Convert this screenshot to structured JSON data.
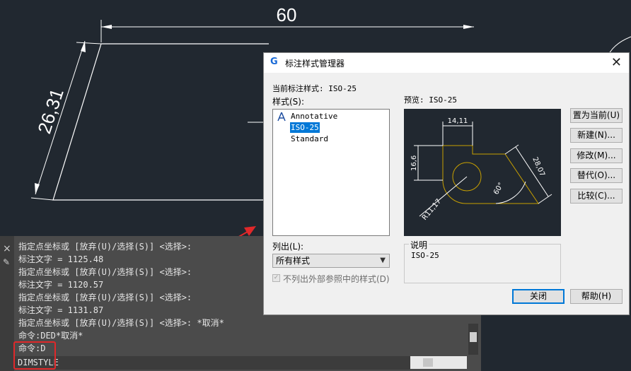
{
  "drawing": {
    "dim_top": "60",
    "dim_left": "26,31"
  },
  "command_window": {
    "lines": [
      "指定点坐标或 [放弃(U)/选择(S)] <选择>:",
      "标注文字 = 1125.48",
      "指定点坐标或 [放弃(U)/选择(S)] <选择>:",
      "标注文字 = 1120.57",
      "指定点坐标或 [放弃(U)/选择(S)] <选择>:",
      "标注文字 = 1131.87",
      "指定点坐标或 [放弃(U)/选择(S)] <选择>: *取消*",
      "命令:DED*取消*",
      "命令:D"
    ],
    "input_value": "DIMSTYLE",
    "close_glyph": "×",
    "pencil_glyph": "✎"
  },
  "dialog": {
    "title": "标注样式管理器",
    "logo": "G",
    "close_glyph": "✕",
    "current_style_label": "当前标注样式: ISO-25",
    "styles_label": "样式(S):",
    "styles": [
      {
        "name": "Annotative",
        "selected": false,
        "icon": "annotative-icon"
      },
      {
        "name": "ISO-25",
        "selected": true
      },
      {
        "name": "Standard",
        "selected": false
      }
    ],
    "preview_label": "预览: ISO-25",
    "list_label": "列出(L):",
    "list_value": "所有样式",
    "checkbox_label": "不列出外部参照中的样式(D)",
    "checkbox_checked": true,
    "description_label": "说明",
    "description_text": "ISO-25",
    "buttons": {
      "set_current": "置为当前(U)",
      "new": "新建(N)...",
      "modify": "修改(M)...",
      "override": "替代(O)...",
      "compare": "比较(C)...",
      "close": "关闭",
      "help": "帮助(H)"
    }
  },
  "preview_dims": {
    "d1": "14,11",
    "d2": "16,6",
    "d3": "28,07",
    "d4": "60°",
    "d5": "R11,17"
  },
  "colors": {
    "canvas": "#212830",
    "highlight_red": "#e0282a",
    "preview_shape": "#c8a000"
  }
}
